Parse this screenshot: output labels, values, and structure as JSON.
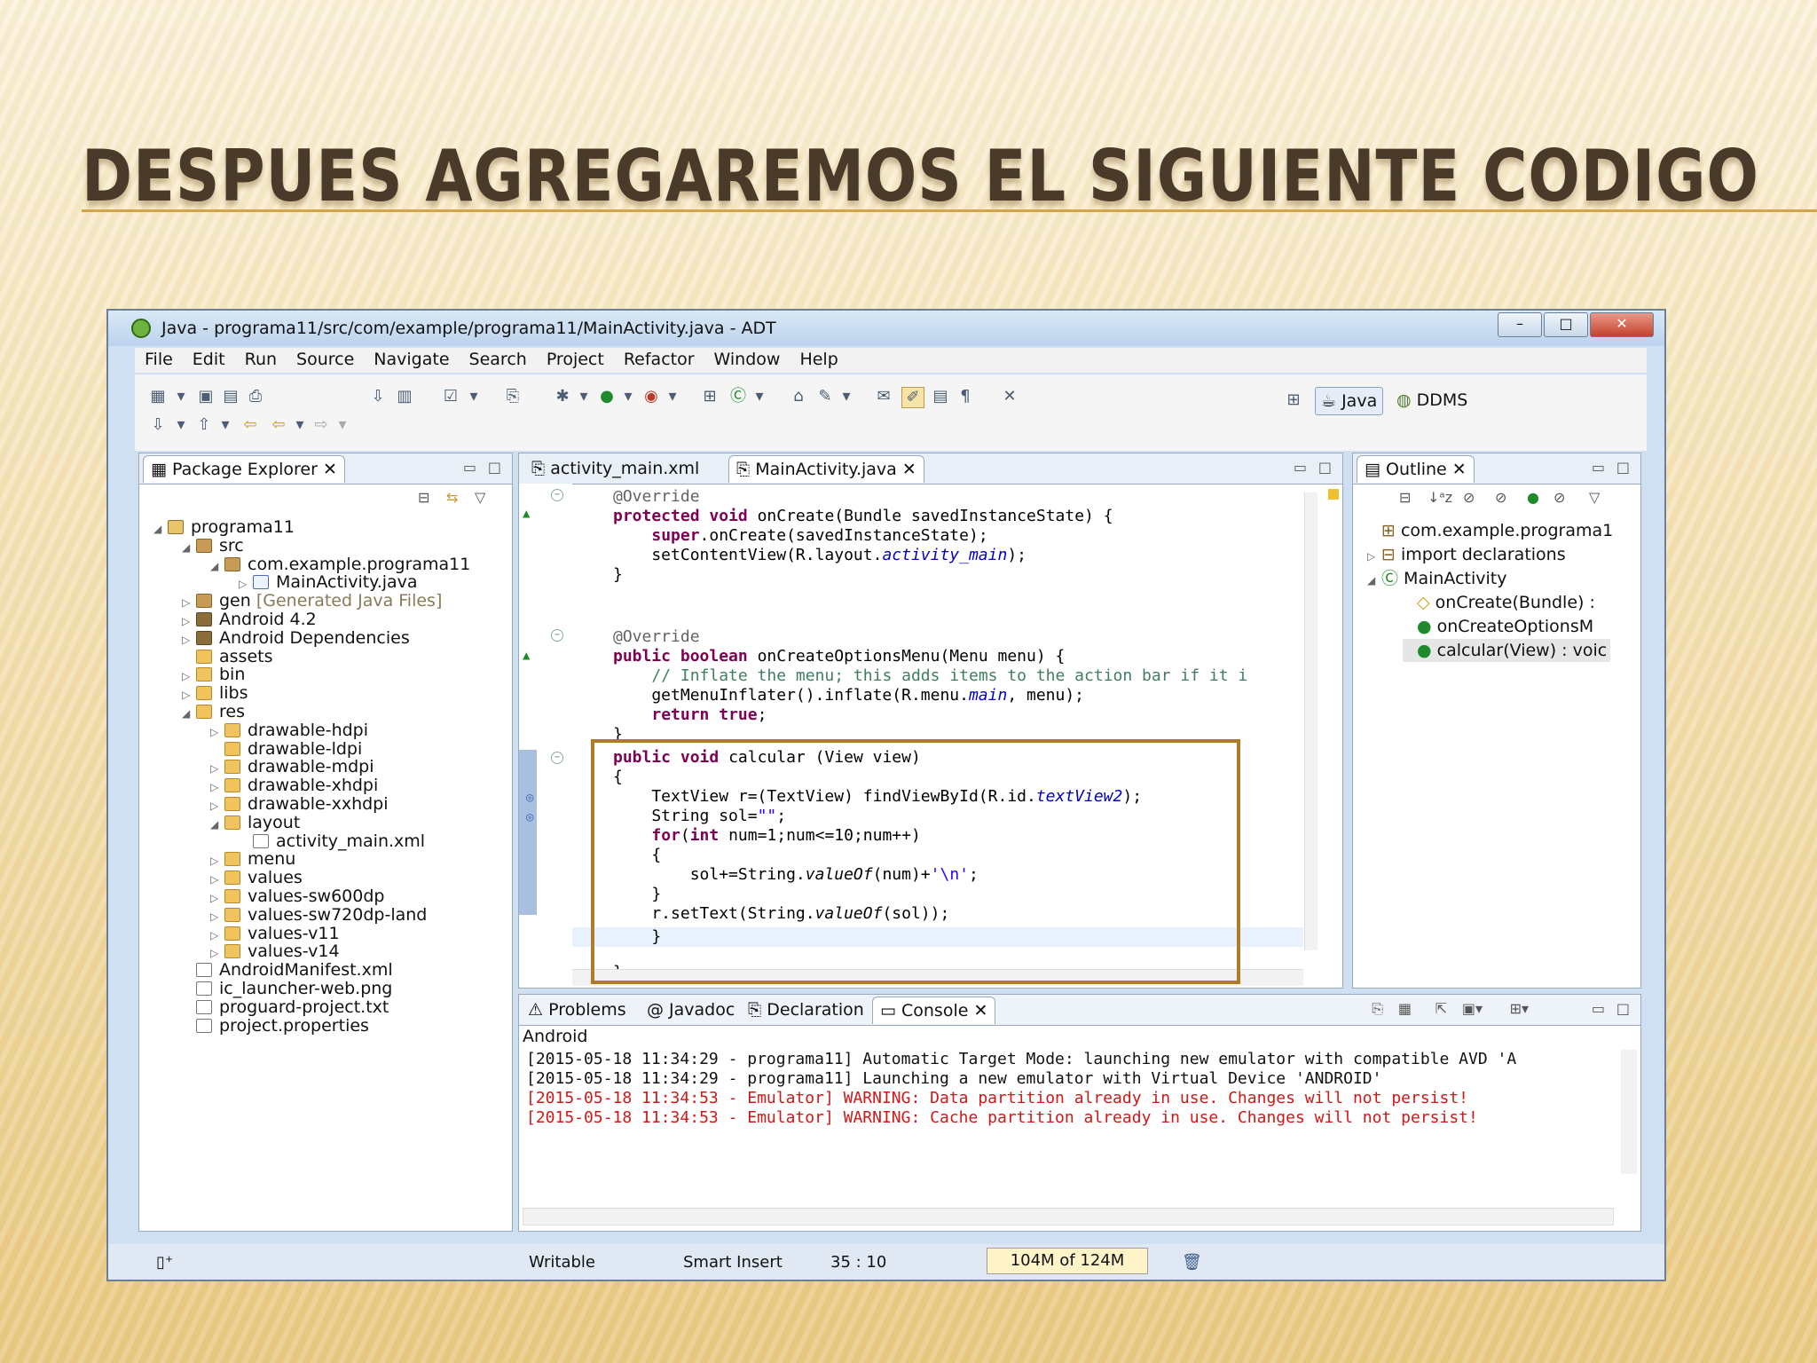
{
  "slide": {
    "title": "DESPUES AGREGAREMOS EL SIGUIENTE CODIGO"
  },
  "window": {
    "title": "Java - programa11/src/com/example/programa11/MainActivity.java - ADT",
    "controls": [
      "–",
      "□",
      "✕"
    ]
  },
  "menu": [
    "File",
    "Edit",
    "Run",
    "Source",
    "Navigate",
    "Search",
    "Project",
    "Refactor",
    "Window",
    "Help"
  ],
  "perspectives": {
    "java": "Java",
    "ddms": "DDMS"
  },
  "package_explorer": {
    "tab": "Package Explorer",
    "tree": [
      {
        "label": "programa11",
        "icon": "project-icon",
        "level": 0,
        "arrow": "◢"
      },
      {
        "label": "src",
        "icon": "package-folder-icon",
        "level": 1,
        "arrow": "◢"
      },
      {
        "label": "com.example.programa11",
        "icon": "package-icon",
        "level": 2,
        "arrow": "◢"
      },
      {
        "label": "MainActivity.java",
        "icon": "java-file-icon",
        "level": 3,
        "arrow": "▷"
      },
      {
        "label": "gen",
        "extra": "[Generated Java Files]",
        "icon": "package-folder-icon",
        "level": 1,
        "arrow": "▷"
      },
      {
        "label": "Android 4.2",
        "icon": "library-icon",
        "level": 1,
        "arrow": "▷"
      },
      {
        "label": "Android Dependencies",
        "icon": "library-icon",
        "level": 1,
        "arrow": "▷"
      },
      {
        "label": "assets",
        "icon": "folder-icon",
        "level": 1,
        "arrow": ""
      },
      {
        "label": "bin",
        "icon": "folder-icon",
        "level": 1,
        "arrow": "▷"
      },
      {
        "label": "libs",
        "icon": "folder-icon",
        "level": 1,
        "arrow": "▷"
      },
      {
        "label": "res",
        "icon": "folder-icon",
        "level": 1,
        "arrow": "◢"
      },
      {
        "label": "drawable-hdpi",
        "icon": "folder-icon",
        "level": 2,
        "arrow": "▷"
      },
      {
        "label": "drawable-ldpi",
        "icon": "folder-icon",
        "level": 2,
        "arrow": ""
      },
      {
        "label": "drawable-mdpi",
        "icon": "folder-icon",
        "level": 2,
        "arrow": "▷"
      },
      {
        "label": "drawable-xhdpi",
        "icon": "folder-icon",
        "level": 2,
        "arrow": "▷"
      },
      {
        "label": "drawable-xxhdpi",
        "icon": "folder-icon",
        "level": 2,
        "arrow": "▷"
      },
      {
        "label": "layout",
        "icon": "folder-icon",
        "level": 2,
        "arrow": "◢"
      },
      {
        "label": "activity_main.xml",
        "icon": "xml-file-icon",
        "level": 3,
        "arrow": ""
      },
      {
        "label": "menu",
        "icon": "folder-icon",
        "level": 2,
        "arrow": "▷"
      },
      {
        "label": "values",
        "icon": "folder-icon",
        "level": 2,
        "arrow": "▷"
      },
      {
        "label": "values-sw600dp",
        "icon": "folder-icon",
        "level": 2,
        "arrow": "▷"
      },
      {
        "label": "values-sw720dp-land",
        "icon": "folder-icon",
        "level": 2,
        "arrow": "▷"
      },
      {
        "label": "values-v11",
        "icon": "folder-icon",
        "level": 2,
        "arrow": "▷"
      },
      {
        "label": "values-v14",
        "icon": "folder-icon",
        "level": 2,
        "arrow": "▷"
      },
      {
        "label": "AndroidManifest.xml",
        "icon": "xml-file-icon",
        "level": 1,
        "arrow": ""
      },
      {
        "label": "ic_launcher-web.png",
        "icon": "image-file-icon",
        "level": 1,
        "arrow": ""
      },
      {
        "label": "proguard-project.txt",
        "icon": "text-file-icon",
        "level": 1,
        "arrow": ""
      },
      {
        "label": "project.properties",
        "icon": "text-file-icon",
        "level": 1,
        "arrow": ""
      }
    ]
  },
  "editor": {
    "tabs": [
      "activity_main.xml",
      "MainActivity.java"
    ],
    "active_tab": "MainActivity.java"
  },
  "outline": {
    "tab": "Outline",
    "items": [
      {
        "label": "com.example.programa1",
        "level": 0,
        "arrow": ""
      },
      {
        "label": "import declarations",
        "level": 0,
        "arrow": "▷"
      },
      {
        "label": "MainActivity",
        "level": 0,
        "arrow": "◢"
      },
      {
        "label": "onCreate(Bundle) :",
        "level": 1,
        "arrow": ""
      },
      {
        "label": "onCreateOptionsM",
        "level": 1,
        "arrow": ""
      },
      {
        "label": "calcular(View) : voic",
        "level": 1,
        "arrow": "",
        "selected": true
      }
    ]
  },
  "bottom": {
    "tabs": [
      "Problems",
      "Javadoc",
      "Declaration",
      "Console"
    ],
    "active_tab": "Console",
    "console_title": "Android",
    "lines": [
      {
        "text": "[2015-05-18 11:34:29 - programa11] Automatic Target Mode: launching new emulator with compatible AVD 'A",
        "error": false
      },
      {
        "text": "[2015-05-18 11:34:29 - programa11] Launching a new emulator with Virtual Device 'ANDROID'",
        "error": false
      },
      {
        "text": "[2015-05-18 11:34:53 - Emulator] WARNING: Data partition already in use. Changes will not persist!",
        "error": true
      },
      {
        "text": "[2015-05-18 11:34:53 - Emulator] WARNING: Cache partition already in use. Changes will not persist!",
        "error": true
      }
    ]
  },
  "status": {
    "writable": "Writable",
    "insert_mode": "Smart Insert",
    "position": "35 : 10",
    "memory": "104M of 124M"
  },
  "colors": {
    "highlight_box": "#b07b26",
    "keyword": "#7f0055",
    "error": "#d01818"
  }
}
